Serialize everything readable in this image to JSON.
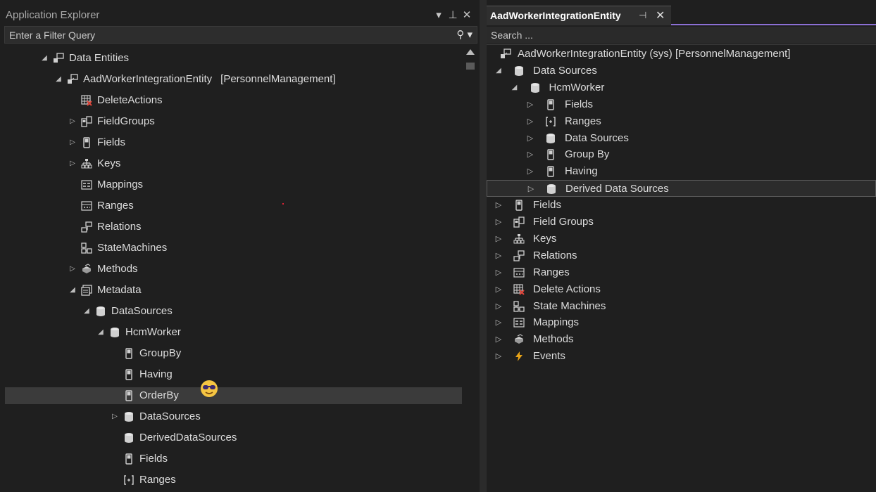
{
  "left": {
    "title": "Application Explorer",
    "filter_placeholder": "Enter a Filter Query",
    "tree": [
      {
        "label": "Data Entities",
        "icon": "data-entities-icon",
        "indent": 0,
        "expander": "expanded"
      },
      {
        "label": "AadWorkerIntegrationEntity",
        "suffix": "[PersonnelManagement]",
        "icon": "entity-icon",
        "indent": 1,
        "expander": "expanded"
      },
      {
        "label": "DeleteActions",
        "icon": "delete-actions-icon",
        "indent": 2,
        "expander": "none"
      },
      {
        "label": "FieldGroups",
        "icon": "field-groups-icon",
        "indent": 2,
        "expander": "collapsed"
      },
      {
        "label": "Fields",
        "icon": "field-icon",
        "indent": 2,
        "expander": "collapsed"
      },
      {
        "label": "Keys",
        "icon": "keys-icon",
        "indent": 2,
        "expander": "collapsed"
      },
      {
        "label": "Mappings",
        "icon": "mappings-icon",
        "indent": 2,
        "expander": "none"
      },
      {
        "label": "Ranges",
        "icon": "ranges-icon",
        "indent": 2,
        "expander": "none"
      },
      {
        "label": "Relations",
        "icon": "relations-icon",
        "indent": 2,
        "expander": "none"
      },
      {
        "label": "StateMachines",
        "icon": "state-machines-icon",
        "indent": 2,
        "expander": "none"
      },
      {
        "label": "Methods",
        "icon": "methods-icon",
        "indent": 2,
        "expander": "collapsed"
      },
      {
        "label": "Metadata",
        "icon": "metadata-icon",
        "indent": 2,
        "expander": "expanded"
      },
      {
        "label": "DataSources",
        "icon": "datasource-icon",
        "indent": 3,
        "expander": "expanded"
      },
      {
        "label": "HcmWorker",
        "icon": "datasource-icon",
        "indent": 4,
        "expander": "expanded"
      },
      {
        "label": "GroupBy",
        "icon": "field-icon",
        "indent": 5,
        "expander": "none"
      },
      {
        "label": "Having",
        "icon": "field-icon",
        "indent": 5,
        "expander": "none"
      },
      {
        "label": "OrderBy",
        "icon": "field-icon",
        "indent": 5,
        "expander": "none",
        "selected": true
      },
      {
        "label": "DataSources",
        "icon": "datasource-icon",
        "indent": 5,
        "expander": "collapsed"
      },
      {
        "label": "DerivedDataSources",
        "icon": "datasource-icon",
        "indent": 5,
        "expander": "none"
      },
      {
        "label": "Fields",
        "icon": "field-icon",
        "indent": 5,
        "expander": "none"
      },
      {
        "label": "Ranges",
        "icon": "range-bracket-icon",
        "indent": 5,
        "expander": "none"
      }
    ]
  },
  "right": {
    "tab_title": "AadWorkerIntegrationEntity",
    "search_placeholder": "Search ...",
    "tree": [
      {
        "label": "AadWorkerIntegrationEntity (sys) [PersonnelManagement]",
        "icon": "entity-icon",
        "indent": 0,
        "expander": "none"
      },
      {
        "label": "Data Sources",
        "icon": "datasource-icon",
        "indent": 0,
        "expander": "expanded"
      },
      {
        "label": "HcmWorker",
        "icon": "datasource-icon",
        "indent": 1,
        "expander": "expanded"
      },
      {
        "label": "Fields",
        "icon": "field-icon",
        "indent": 2,
        "expander": "collapsed"
      },
      {
        "label": "Ranges",
        "icon": "range-bracket-icon",
        "indent": 2,
        "expander": "collapsed"
      },
      {
        "label": "Data Sources",
        "icon": "datasource-icon",
        "indent": 2,
        "expander": "collapsed"
      },
      {
        "label": "Group By",
        "icon": "field-icon",
        "indent": 2,
        "expander": "collapsed"
      },
      {
        "label": "Having",
        "icon": "field-icon",
        "indent": 2,
        "expander": "collapsed"
      },
      {
        "label": "Derived Data Sources",
        "icon": "datasource-icon",
        "indent": 2,
        "expander": "collapsed",
        "selected": true
      },
      {
        "label": "Fields",
        "icon": "field-icon",
        "indent": 0,
        "expander": "collapsed"
      },
      {
        "label": "Field Groups",
        "icon": "field-groups-icon",
        "indent": 0,
        "expander": "collapsed"
      },
      {
        "label": "Keys",
        "icon": "keys-icon",
        "indent": 0,
        "expander": "collapsed"
      },
      {
        "label": "Relations",
        "icon": "relations-icon",
        "indent": 0,
        "expander": "collapsed"
      },
      {
        "label": "Ranges",
        "icon": "ranges-icon",
        "indent": 0,
        "expander": "collapsed"
      },
      {
        "label": "Delete Actions",
        "icon": "delete-actions-icon",
        "indent": 0,
        "expander": "collapsed"
      },
      {
        "label": "State Machines",
        "icon": "state-machines-icon",
        "indent": 0,
        "expander": "collapsed"
      },
      {
        "label": "Mappings",
        "icon": "mappings-icon",
        "indent": 0,
        "expander": "collapsed"
      },
      {
        "label": "Methods",
        "icon": "methods-icon",
        "indent": 0,
        "expander": "collapsed"
      },
      {
        "label": "Events",
        "icon": "events-icon",
        "indent": 0,
        "expander": "collapsed"
      }
    ]
  }
}
